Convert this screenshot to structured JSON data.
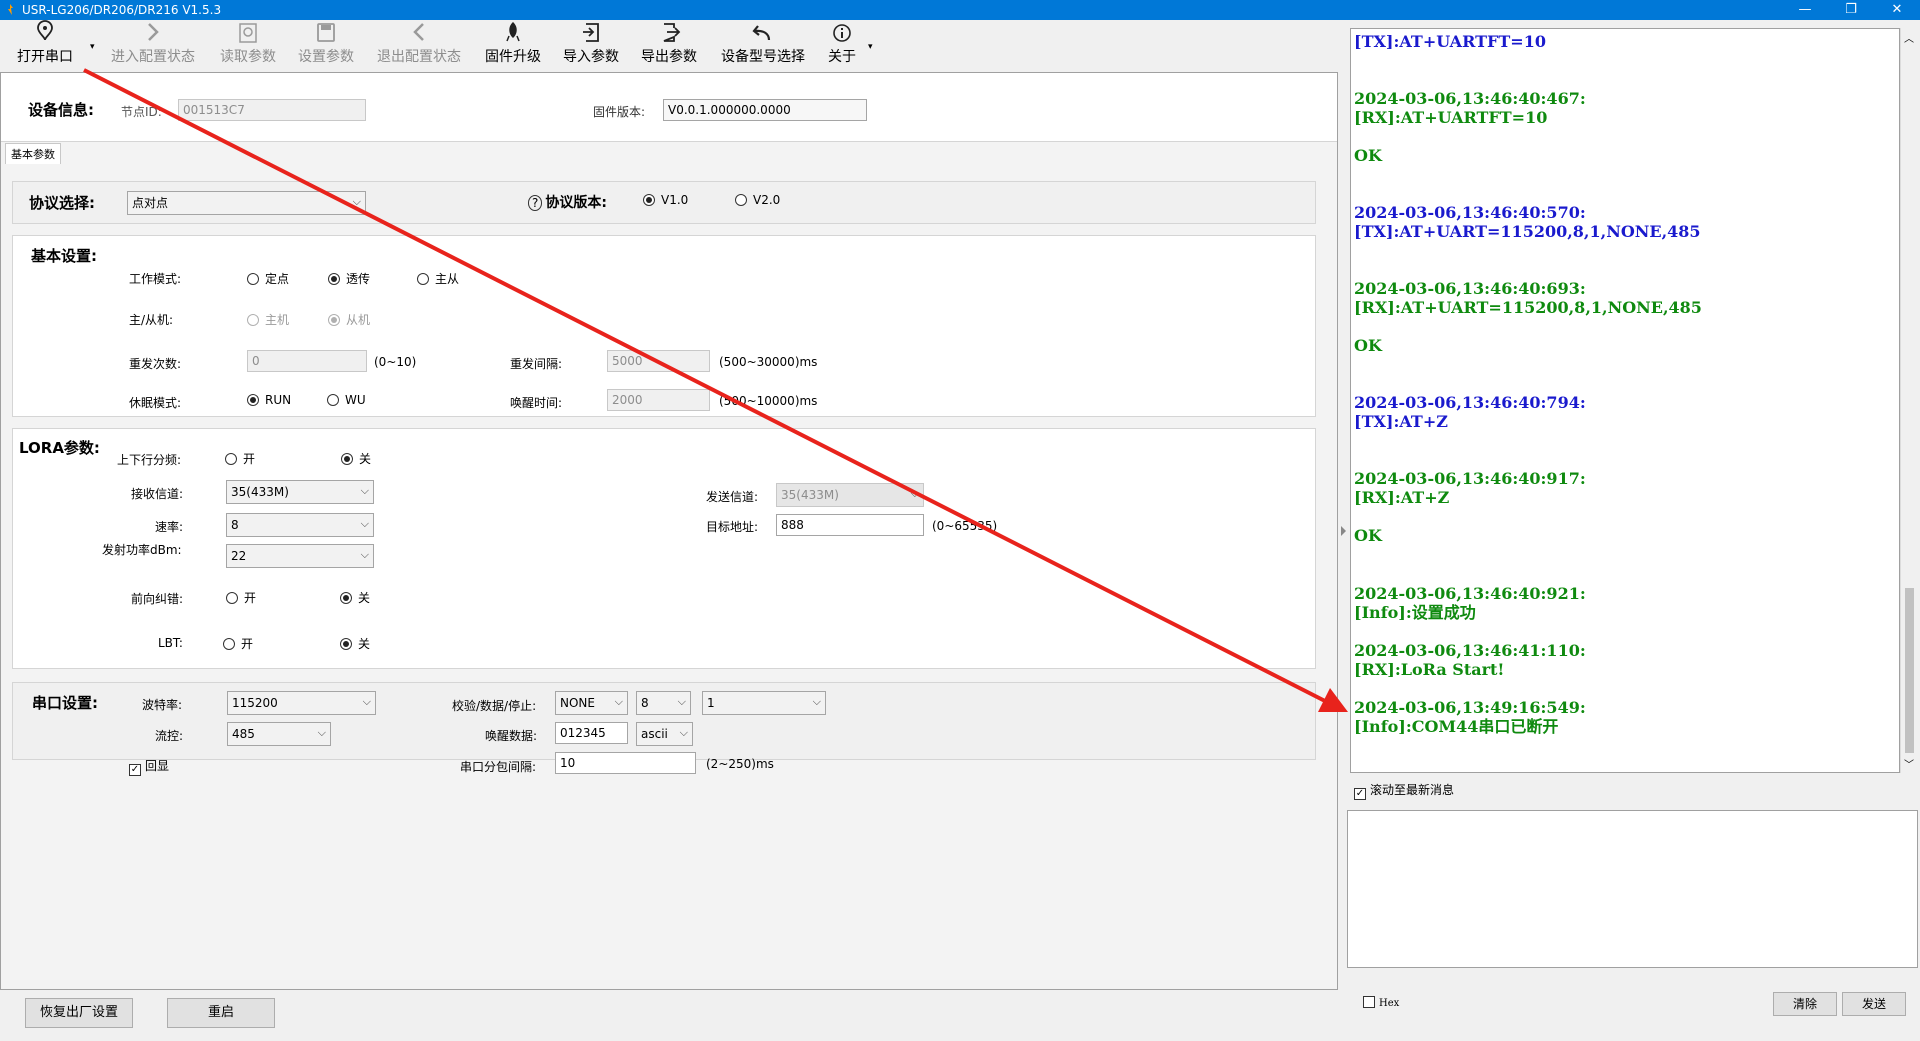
{
  "app": {
    "title": "USR-LG206/DR206/DR216 V1.5.3",
    "minimize": "—",
    "maximize": "❐",
    "close": "✕"
  },
  "toolbar": {
    "items": [
      {
        "label": "打开串口",
        "icon": "plug-icon"
      },
      {
        "label": "进入配置状态",
        "icon": "chevron-right-icon"
      },
      {
        "label": "读取参数",
        "icon": "read-icon"
      },
      {
        "label": "设置参数",
        "icon": "save-icon"
      },
      {
        "label": "退出配置状态",
        "icon": "chevron-left-icon"
      },
      {
        "label": "固件升级",
        "icon": "upgrade-icon"
      },
      {
        "label": "导入参数",
        "icon": "import-icon"
      },
      {
        "label": "导出参数",
        "icon": "export-icon"
      },
      {
        "label": "设备型号选择",
        "icon": "undo-icon"
      },
      {
        "label": "关于",
        "icon": "info-icon"
      }
    ],
    "caret": "▾"
  },
  "device_info": {
    "title": "设备信息:",
    "node_id_label": "节点ID:",
    "node_id_value": "001513C7",
    "fw_label": "固件版本:",
    "fw_value": "V0.0.1.000000.0000"
  },
  "tab": {
    "label": "基本参数"
  },
  "protocol": {
    "title": "协议选择:",
    "selected": "点对点",
    "version_label": "协议版本:",
    "help_icon": "?",
    "v1": "V1.0",
    "v2": "V2.0"
  },
  "basic": {
    "title": "基本设置:",
    "work_mode_label": "工作模式:",
    "work_mode_options": [
      "定点",
      "透传",
      "主从"
    ],
    "master_slave_label": "主/从机:",
    "master_slave_options": [
      "主机",
      "从机"
    ],
    "retry_count_label": "重发次数:",
    "retry_count_value": "0",
    "retry_count_range": "(0~10)",
    "retry_interval_label": "重发间隔:",
    "retry_interval_value": "5000",
    "retry_interval_range": "(500~30000)ms",
    "sleep_mode_label": "休眠模式:",
    "sleep_mode_options": [
      "RUN",
      "WU"
    ],
    "wake_time_label": "唤醒时间:",
    "wake_time_value": "2000",
    "wake_time_range": "(500~10000)ms"
  },
  "lora": {
    "title": "LORA参数:",
    "updown_label": "上下行分频:",
    "on": "开",
    "off": "关",
    "rx_channel_label": "接收信道:",
    "rx_channel_value": "35(433M)",
    "tx_channel_label": "发送信道:",
    "tx_channel_value": "35(433M)",
    "rate_label": "速率:",
    "rate_value": "8",
    "target_addr_label": "目标地址:",
    "target_addr_value": "888",
    "target_addr_range": "(0~65535)",
    "power_label": "发射功率dBm:",
    "power_value": "22",
    "fec_label": "前向纠错:",
    "lbt_label": "LBT:"
  },
  "serial": {
    "title": "串口设置:",
    "baud_label": "波特率:",
    "baud_value": "115200",
    "parity_label": "校验/数据/停止:",
    "parity_value": "NONE",
    "data_bits_value": "8",
    "stop_bits_value": "1",
    "flow_label": "流控:",
    "flow_value": "485",
    "wake_data_label": "唤醒数据:",
    "wake_data_value": "012345",
    "wake_data_format": "ascii",
    "echo_label": "回显",
    "packet_interval_label": "串口分包间隔:",
    "packet_interval_value": "10",
    "packet_interval_range": "(2~250)ms"
  },
  "bottom": {
    "factory_reset": "恢复出厂设置",
    "restart": "重启"
  },
  "log": {
    "entries": [
      {
        "kind": "tx",
        "text": "[TX]:AT+UARTFT=10"
      },
      {
        "kind": "rx",
        "text": "2024-03-06,13:46:40:467:\n[RX]:AT+UARTFT=10\n\nOK"
      },
      {
        "kind": "tx",
        "text": "2024-03-06,13:46:40:570:\n[TX]:AT+UART=115200,8,1,NONE,485"
      },
      {
        "kind": "rx",
        "text": "2024-03-06,13:46:40:693:\n[RX]:AT+UART=115200,8,1,NONE,485\n\nOK"
      },
      {
        "kind": "tx",
        "text": "2024-03-06,13:46:40:794:\n[TX]:AT+Z"
      },
      {
        "kind": "rx",
        "text": "2024-03-06,13:46:40:917:\n[RX]:AT+Z\n\nOK"
      },
      {
        "kind": "rx",
        "text": "2024-03-06,13:46:40:921:\n[Info]:设置成功"
      },
      {
        "kind": "rx",
        "text": "2024-03-06,13:46:41:110:\n[RX]:LoRa Start!"
      },
      {
        "kind": "rx",
        "text": "2024-03-06,13:49:16:549:\n[Info]:COM44串口已断开"
      }
    ],
    "autoscroll_label": "滚动至最新消息"
  },
  "send": {
    "hex_label": "Hex",
    "clear": "清除",
    "send": "发送"
  },
  "colors": {
    "titlebar": "#0078d7",
    "tx": "#1a1acd",
    "rx": "#0f8a0f",
    "arrow": "#e8231c"
  }
}
